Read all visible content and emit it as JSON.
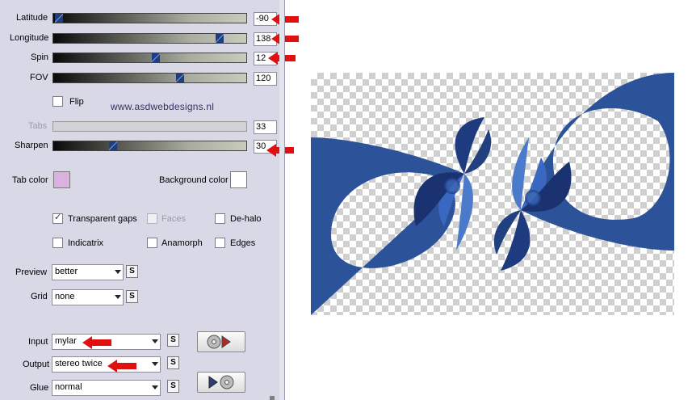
{
  "sliders": [
    {
      "label": "Latitude",
      "value": "-90",
      "level": 0.02
    },
    {
      "label": "Longitude",
      "value": "138",
      "level": 0.88
    },
    {
      "label": "Spin",
      "value": "12",
      "level": 0.52
    },
    {
      "label": "FOV",
      "value": "120",
      "level": 0.66
    }
  ],
  "flip_label": "Flip",
  "watermark": "www.asdwebdesigns.nl",
  "tabs": {
    "label": "Tabs",
    "value": "33"
  },
  "sharpen": {
    "label": "Sharpen",
    "value": "30",
    "level": 0.3
  },
  "tab_color": {
    "label": "Tab color",
    "color": "#d9b2e0"
  },
  "background_color": {
    "label": "Background color",
    "color": "#ffffff"
  },
  "options": {
    "transparent_gaps": {
      "label": "Transparent gaps",
      "checked": true
    },
    "faces": {
      "label": "Faces",
      "checked": false
    },
    "de_halo": {
      "label": "De-halo",
      "checked": false
    },
    "indicatrix": {
      "label": "Indicatrix",
      "checked": false
    },
    "anamorph": {
      "label": "Anamorph",
      "checked": false
    },
    "edges": {
      "label": "Edges",
      "checked": false
    }
  },
  "preview": {
    "label": "Preview",
    "value": "better"
  },
  "grid": {
    "label": "Grid",
    "value": "none"
  },
  "input": {
    "label": "Input",
    "value": "mylar"
  },
  "output": {
    "label": "Output",
    "value": "stereo twice"
  },
  "glue": {
    "label": "Glue",
    "value": "normal"
  },
  "s_button_label": "S",
  "colors": {
    "accent_blue": "#2a4f9a",
    "arrow_red": "#e01010"
  }
}
